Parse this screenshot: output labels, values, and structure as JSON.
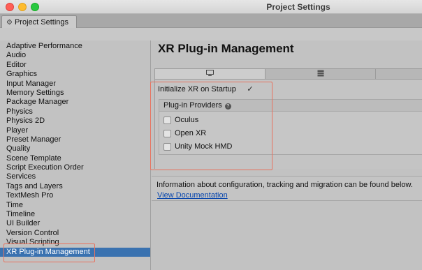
{
  "window": {
    "title": "Project Settings",
    "tab_label": "Project Settings"
  },
  "sidebar": {
    "items": [
      {
        "label": "Adaptive Performance"
      },
      {
        "label": "Audio"
      },
      {
        "label": "Editor"
      },
      {
        "label": "Graphics"
      },
      {
        "label": "Input Manager"
      },
      {
        "label": "Memory Settings"
      },
      {
        "label": "Package Manager"
      },
      {
        "label": "Physics"
      },
      {
        "label": "Physics 2D"
      },
      {
        "label": "Player"
      },
      {
        "label": "Preset Manager"
      },
      {
        "label": "Quality"
      },
      {
        "label": "Scene Template"
      },
      {
        "label": "Script Execution Order"
      },
      {
        "label": "Services"
      },
      {
        "label": "Tags and Layers"
      },
      {
        "label": "TextMesh Pro"
      },
      {
        "label": "Time"
      },
      {
        "label": "Timeline"
      },
      {
        "label": "UI Builder"
      },
      {
        "label": "Version Control"
      },
      {
        "label": "Visual Scripting"
      },
      {
        "label": "XR Plug-in Management",
        "selected": true
      }
    ]
  },
  "main": {
    "title": "XR Plug-in Management",
    "platform_tabs": [
      {
        "icon": "monitor-icon",
        "active": true
      },
      {
        "icon": "server-icon",
        "active": false
      },
      {
        "icon": "",
        "active": false
      }
    ],
    "initialize_label": "Initialize XR on Startup",
    "initialize_checked": true,
    "check_glyph": "✓",
    "providers_header": "Plug-in Providers",
    "help_glyph": "?",
    "providers": [
      {
        "label": "Oculus",
        "checked": false
      },
      {
        "label": "Open XR",
        "checked": false
      },
      {
        "label": "Unity Mock HMD",
        "checked": false
      }
    ],
    "info_text": "Information about configuration, tracking and migration can be found below.",
    "link_text": "View Documentation"
  },
  "colors": {
    "selection": "#3a72b0",
    "highlight_box": "#e8735f",
    "link": "#0645ad"
  }
}
